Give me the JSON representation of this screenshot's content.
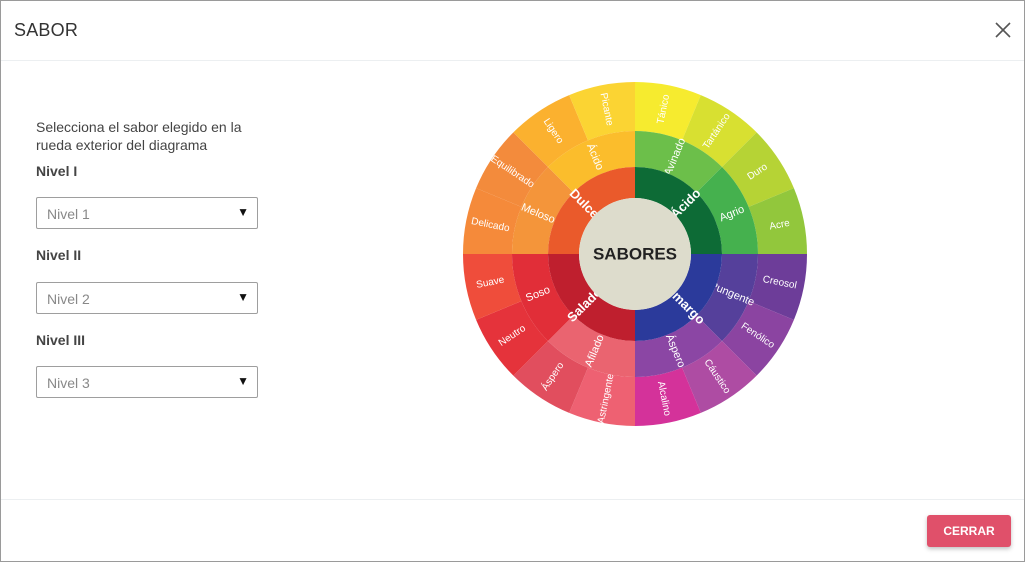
{
  "modal": {
    "title": "SABOR",
    "close_icon": "close-x-icon",
    "close_button_label": "CERRAR"
  },
  "form": {
    "instructions": "Selecciona el sabor elegido en la rueda exterior del diagrama",
    "levels": [
      {
        "label": "Nivel I",
        "placeholder": "Nivel 1"
      },
      {
        "label": "Nivel II",
        "placeholder": "Nivel 2"
      },
      {
        "label": "Nivel III",
        "placeholder": "Nivel 3"
      }
    ],
    "caret_icon": "▼"
  },
  "wheel": {
    "center_label": "SABORES",
    "center_color": "#dddccc",
    "level1": [
      {
        "label": "Ácido",
        "color": "#0d6b36"
      },
      {
        "label": "Amargo",
        "color": "#2b3a9b"
      },
      {
        "label": "Salado",
        "color": "#bf1f2e"
      },
      {
        "label": "Dulce",
        "color": "#ea5a2b"
      }
    ],
    "level2": [
      {
        "label": "Avinado",
        "color": "#6cbf4a"
      },
      {
        "label": "Agrio",
        "color": "#45b14e"
      },
      {
        "label": "Pungente",
        "color": "#55409b"
      },
      {
        "label": "Áspero",
        "color": "#8b46a4"
      },
      {
        "label": "Afilado",
        "color": "#ea6470"
      },
      {
        "label": "Soso",
        "color": "#e12e38"
      },
      {
        "label": "Meloso",
        "color": "#f4953a"
      },
      {
        "label": "Ácido",
        "color": "#fbbd2c"
      }
    ],
    "level3": [
      {
        "label": "Tánico",
        "color": "#f6eb2f"
      },
      {
        "label": "Tartánico",
        "color": "#d8e031"
      },
      {
        "label": "Duro",
        "color": "#b6d335"
      },
      {
        "label": "Acre",
        "color": "#92c73c"
      },
      {
        "label": "Creosol",
        "color": "#6d3d99"
      },
      {
        "label": "Fenólico",
        "color": "#8b44a1"
      },
      {
        "label": "Cáustico",
        "color": "#ae4ca3"
      },
      {
        "label": "Alcalino",
        "color": "#d4329a"
      },
      {
        "label": "Astringente",
        "color": "#ee6172"
      },
      {
        "label": "Áspero",
        "color": "#e14e5e"
      },
      {
        "label": "Neutro",
        "color": "#e5333b"
      },
      {
        "label": "Suave",
        "color": "#ef4d3b"
      },
      {
        "label": "Delicado",
        "color": "#f58a3a"
      },
      {
        "label": "Equilibrado",
        "color": "#f38b3c"
      },
      {
        "label": "Ligero",
        "color": "#fbb12f"
      },
      {
        "label": "Picante",
        "color": "#fbd433"
      }
    ]
  }
}
